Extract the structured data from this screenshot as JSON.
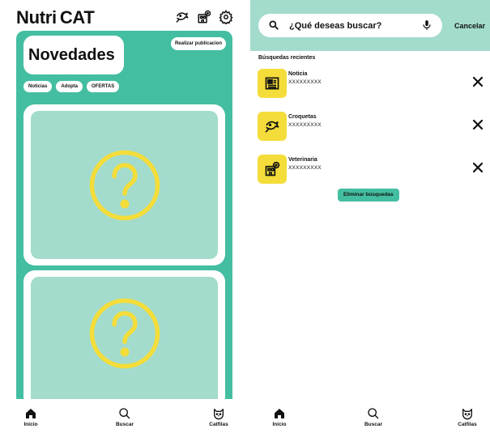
{
  "left": {
    "logo": {
      "part1": "Nutri",
      "part2": "CAT"
    },
    "top_icons": [
      "fish-icon",
      "vet-clinic-icon",
      "gear-icon"
    ],
    "headline": "Novedades",
    "publish_button": "Realizar publicacion",
    "chips": [
      "Noticias",
      "Adopta",
      "OFERTAS"
    ],
    "cards": [
      {
        "placeholder_icon": "question-icon"
      },
      {
        "placeholder_icon": "question-icon"
      }
    ],
    "nav": [
      {
        "label": "Inicio",
        "icon": "home-icon"
      },
      {
        "label": "Buscar",
        "icon": "search-icon"
      },
      {
        "label": "Catfilas",
        "icon": "cat-icon"
      }
    ]
  },
  "right": {
    "search": {
      "placeholder": "¿Qué deseas buscar?"
    },
    "cancel_label": "Cancelar",
    "recent_title": "Búsquedas recientes",
    "recent": [
      {
        "title": "Noticia",
        "subtitle": "XXXXXXXXX",
        "icon": "newspaper-icon"
      },
      {
        "title": "Croquetas",
        "subtitle": "XXXXXXXXX",
        "icon": "fish-icon"
      },
      {
        "title": "Veterinaria",
        "subtitle": "XXXXXXXXX",
        "icon": "vet-clinic-icon"
      }
    ],
    "clear_button": "Eliminar búsquedas",
    "nav": [
      {
        "label": "Inicio",
        "icon": "home-icon"
      },
      {
        "label": "Buscar",
        "icon": "search-icon"
      },
      {
        "label": "Catfilas",
        "icon": "cat-icon"
      }
    ]
  },
  "colors": {
    "teal": "#44bea1",
    "mint": "#a3dccc",
    "yellow": "#f4dd3a",
    "text": "#111111"
  }
}
